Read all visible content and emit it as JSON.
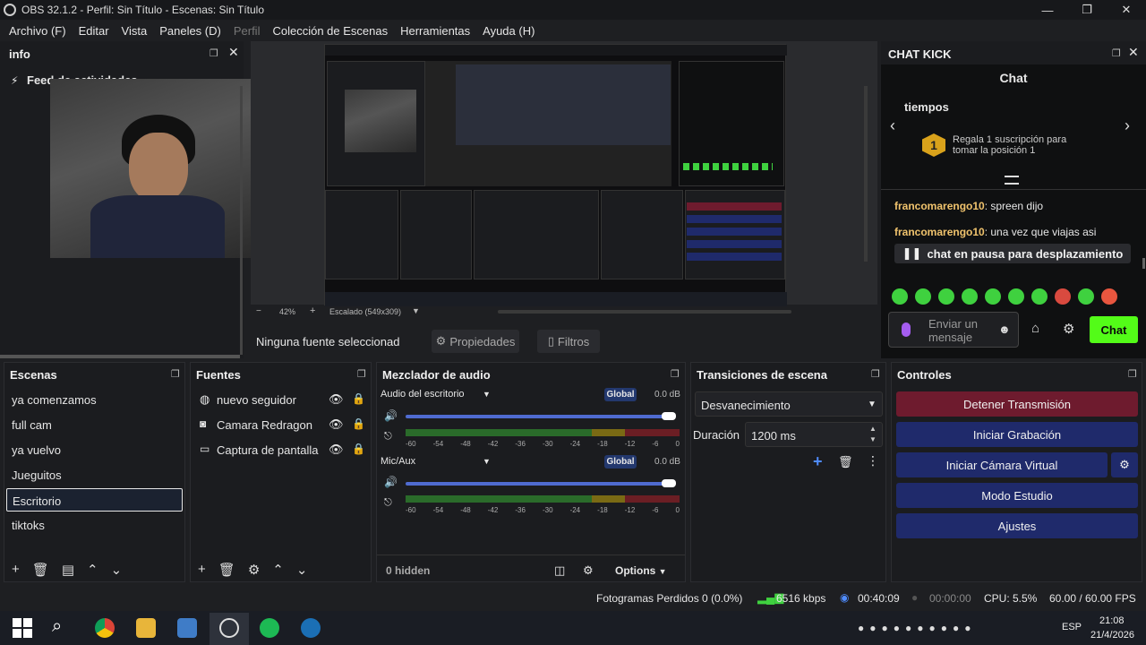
{
  "window": {
    "title": "OBS 32.1.2 - Perfil: Sin Título - Escenas: Sin Título"
  },
  "menu": [
    "Archivo (F)",
    "Editar",
    "Vista",
    "Paneles (D)",
    "Perfil",
    "Colección de Escenas",
    "Herramientas",
    "Ayuda (H)"
  ],
  "info_dock": {
    "title": "info",
    "item": "Feed de actividades"
  },
  "preview": {
    "zoom": "42%",
    "scale": "Escalado (549x309)",
    "no_source": "Ninguna fuente seleccionad",
    "props_label": "Propiedades",
    "filters_label": "Filtros"
  },
  "chat": {
    "dock_title": "CHAT KICK",
    "header": "Chat",
    "pinned_title": "tiempos",
    "rank": "1",
    "goal_text": "Regala 1 suscripción para tomar la posición 1",
    "messages": [
      {
        "user": "francomarengo10",
        "text": "spreen dijo"
      },
      {
        "user": "francomarengo10",
        "text": "una vez que viajas asi"
      }
    ],
    "paused": "chat en pausa para desplazamiento",
    "input_placeholder": "Enviar un mensaje",
    "send_label": "Chat"
  },
  "scenes": {
    "title": "Escenas",
    "items": [
      "ya comenzamos",
      "full cam",
      "ya vuelvo",
      "Jueguitos",
      "Escritorio",
      "tiktoks"
    ],
    "selected": "Escritorio"
  },
  "sources": {
    "title": "Fuentes",
    "items": [
      "nuevo seguidor",
      "Camara Redragon",
      "Captura de pantalla"
    ]
  },
  "mixer": {
    "title": "Mezclador de audio",
    "channels": [
      {
        "name": "Audio del escritorio",
        "badge": "Global",
        "db": "0.0 dB"
      },
      {
        "name": "Mic/Aux",
        "badge": "Global",
        "db": "0.0 dB"
      }
    ],
    "ticks": [
      "-60",
      "-54",
      "-48",
      "-42",
      "-36",
      "-30",
      "-24",
      "-18",
      "-12",
      "-6",
      "0"
    ],
    "hidden": "0 hidden",
    "options": "Options"
  },
  "transitions": {
    "title": "Transiciones de escena",
    "selected": "Desvanecimiento",
    "duration_label": "Duración",
    "duration_value": "1200 ms"
  },
  "controls": {
    "title": "Controles",
    "stop_stream": "Detener Transmisión",
    "start_record": "Iniciar Grabación",
    "virtual_cam": "Iniciar Cámara Virtual",
    "studio_mode": "Modo Estudio",
    "settings": "Ajustes",
    "colors": {
      "stop": "#6e1b2e",
      "normal": "#1f2a6b"
    }
  },
  "status": {
    "dropped": "Fotogramas Perdidos 0 (0.0%)",
    "bitrate": "6516 kbps",
    "stream_time": "00:40:09",
    "record_time": "00:00:00",
    "cpu": "CPU: 5.5%",
    "fps": "60.00 / 60.00 FPS"
  },
  "taskbar": {
    "lang": "ESP",
    "time": "21:08",
    "date": "21/4/2026"
  }
}
